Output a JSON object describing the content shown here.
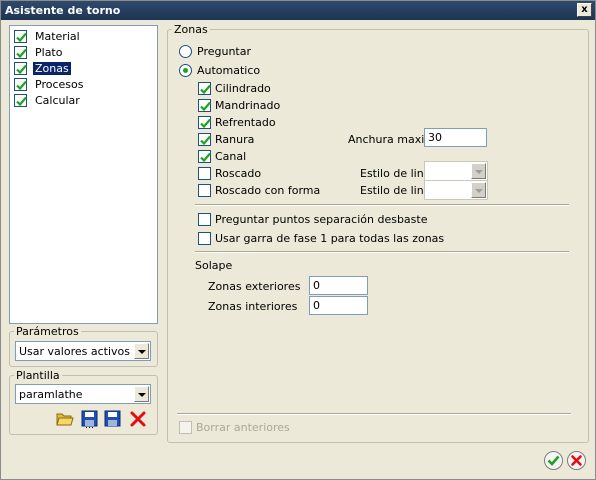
{
  "window": {
    "title": "Asistente de torno",
    "close_label": "x"
  },
  "tree": {
    "items": [
      {
        "label": "Material",
        "checked": true,
        "selected": false
      },
      {
        "label": "Plato",
        "checked": true,
        "selected": false
      },
      {
        "label": "Zonas",
        "checked": true,
        "selected": true
      },
      {
        "label": "Procesos",
        "checked": true,
        "selected": false
      },
      {
        "label": "Calcular",
        "checked": true,
        "selected": false
      }
    ]
  },
  "parametros": {
    "legend": "Parámetros",
    "selected": "Usar valores activos"
  },
  "plantilla": {
    "legend": "Plantilla",
    "selected": "paramlathe"
  },
  "zonas": {
    "legend": "Zonas",
    "radio_preguntar": "Preguntar",
    "radio_automatico": "Automatico",
    "options": {
      "cilindrado": "Cilindrado",
      "mandrinado": "Mandrinado",
      "refrentado": "Refrentado",
      "ranura": "Ranura",
      "canal": "Canal",
      "roscado": "Roscado",
      "roscado_forma": "Roscado con forma"
    },
    "anchura_label": "Anchura maxima",
    "anchura_value": "30",
    "estilo_label_1": "Estilo de linea",
    "estilo_label_2": "Estilo de linea",
    "preguntar_puntos": "Preguntar puntos separación desbaste",
    "usar_garra": "Usar garra de fase 1 para todas las zonas",
    "solape": {
      "label": "Solape",
      "exteriores_label": "Zonas exteriores",
      "exteriores_value": "0",
      "interiores_label": "Zonas interiores",
      "interiores_value": "0"
    },
    "borrar_anteriores": "Borrar anteriores"
  },
  "icons": {
    "open": "folder-open-icon",
    "save": "save-icon",
    "save_as": "save-as-icon",
    "delete": "delete-icon",
    "ok": "check-icon",
    "cancel": "cancel-icon"
  },
  "colors": {
    "title_bar": "#2f4a6c",
    "selection": "#0a246a",
    "check_green": "#21a121",
    "delete_red": "#e01010"
  }
}
